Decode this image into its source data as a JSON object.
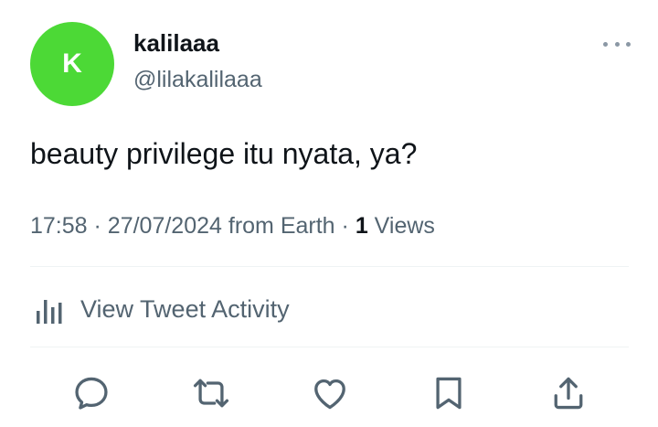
{
  "user": {
    "avatar_letter": "K",
    "avatar_color": "#4cd936",
    "display_name": "kalilaaa",
    "handle": "@lilakalilaaa"
  },
  "tweet": {
    "text": "beauty privilege itu nyata, ya?",
    "time": "17:58",
    "date": "27/07/2024",
    "source": "from Earth",
    "views_count": "1",
    "views_label": "Views"
  },
  "activity": {
    "icon": "analytics-icon",
    "label": "View Tweet Activity"
  },
  "actions": [
    {
      "name": "reply",
      "icon": "reply-icon"
    },
    {
      "name": "retweet",
      "icon": "retweet-icon"
    },
    {
      "name": "like",
      "icon": "heart-icon"
    },
    {
      "name": "bookmark",
      "icon": "bookmark-icon"
    },
    {
      "name": "share",
      "icon": "share-icon"
    }
  ],
  "colors": {
    "primary_text": "#0f1419",
    "secondary_text": "#536471",
    "divider": "#eff3f4",
    "icon": "#536471"
  }
}
